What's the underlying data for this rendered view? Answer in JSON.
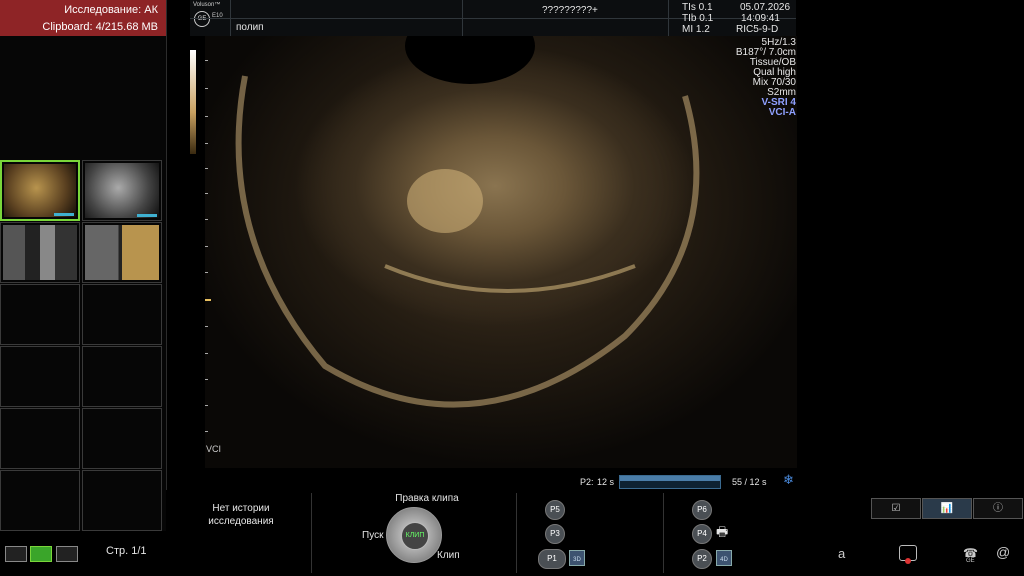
{
  "study": {
    "label": "Исследование: АК",
    "clipboard": "Clipboard: 4/215.68 MB"
  },
  "top_bar": {
    "brand": "Voluson™",
    "model": "E10",
    "logo": "GE",
    "title": "?????????+",
    "annotation": "полип",
    "tis": "TIs  0.1",
    "tib": "TIb  0.1",
    "mi": "MI   1.2",
    "date": "05.07.2026",
    "time": "14:09:41",
    "probe": "RIC5-9-D"
  },
  "params": [
    "5Hz/1.3",
    "B187°/ 7.0cm",
    "Tissue/OB",
    "Qual high",
    "Mix 70/30",
    "S2mm"
  ],
  "params_blue": [
    "V-SRI 4",
    "VCI-A"
  ],
  "vci_label": "VCI",
  "cine": {
    "label": "P2:",
    "start": "12 s",
    "end": "55 / 12 s",
    "icon": "snowflake-icon"
  },
  "history": {
    "line1": "Нет истории",
    "line2": "исследования"
  },
  "clip": {
    "title": "Правка клипа",
    "play": "Пуск",
    "center": "КЛИП",
    "clip": "Клип"
  },
  "p_buttons": [
    "P5",
    "P3",
    "P1",
    "P6",
    "P4",
    "P2"
  ],
  "disk_labels": [
    "3D",
    "4D"
  ],
  "page": "Стр. 1/1",
  "status": {
    "a": "a",
    "at": "@",
    "ge": "GE"
  },
  "colors": {
    "header_red": "#8e2426",
    "selection_green": "#7ad63a",
    "accent_blue": "#8fa0ff"
  }
}
